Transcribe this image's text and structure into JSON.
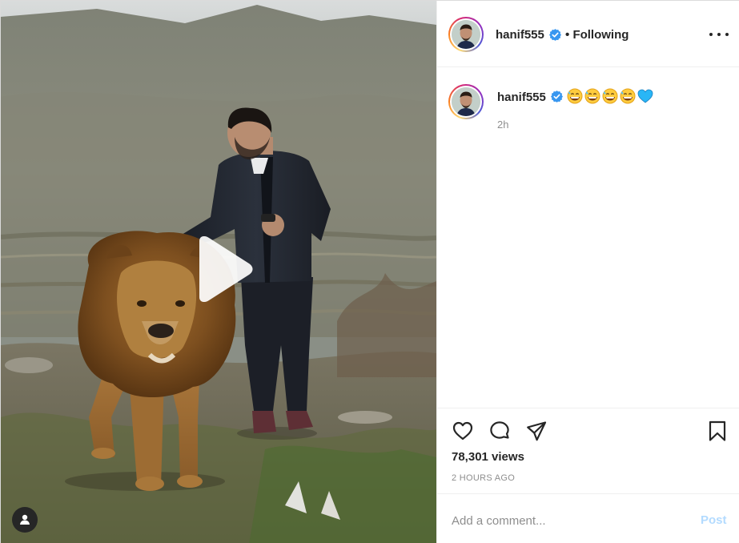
{
  "post": {
    "username": "hanif555",
    "separator": "•",
    "follow_status": "Following",
    "caption_emojis": [
      "grinning-sweat-emoji",
      "grinning-sweat-emoji",
      "grinning-sweat-emoji",
      "grinning-sweat-emoji",
      "blue-heart-emoji"
    ],
    "caption_time": "2h",
    "views": "78,301 views",
    "posted_ago": "2 HOURS AGO"
  },
  "comment": {
    "placeholder": "Add a comment...",
    "post_label": "Post"
  },
  "colors": {
    "verified_blue": "#3897f0",
    "post_disabled": "#b3dbff",
    "muted_text": "#8e8e8e"
  },
  "icons": {
    "like": "heart-icon",
    "comment": "comment-icon",
    "share": "paper-plane-icon",
    "save": "bookmark-icon",
    "more": "more-options-icon",
    "play": "play-icon",
    "user_tag": "user-tag-icon",
    "verified": "verified-badge-icon"
  }
}
